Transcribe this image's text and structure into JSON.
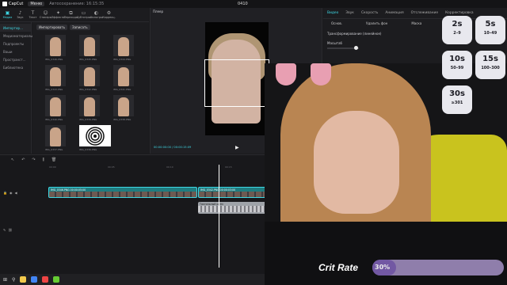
{
  "titlebar": {
    "app": "CapCut",
    "menu": "Меню",
    "autosave": "Автосохранение: 16:15:35",
    "title": "0410"
  },
  "toolbar": [
    {
      "label": "Медиа",
      "icon": "media-icon",
      "active": true
    },
    {
      "label": "Звук",
      "icon": "audio-icon"
    },
    {
      "label": "Текст",
      "icon": "text-icon"
    },
    {
      "label": "Стикеры",
      "icon": "sticker-icon"
    },
    {
      "label": "Эффекты",
      "icon": "effects-icon"
    },
    {
      "label": "Переходы",
      "icon": "transitions-icon"
    },
    {
      "label": "Субтитры",
      "icon": "subtitles-icon"
    },
    {
      "label": "Фильтры",
      "icon": "filters-icon"
    },
    {
      "label": "Коррекц.",
      "icon": "adjust-icon"
    }
  ],
  "sidebar": [
    "Импортир...",
    "Медиаматериалы",
    "Подпроекты",
    "Ваши",
    "Пространст...",
    "Библиотека"
  ],
  "media": {
    "import_btn": "Импортировать",
    "record_btn": "Записать",
    "clips": [
      {
        "name": "IMG_0346.PNG",
        "tag": "Добавлено"
      },
      {
        "name": "IMG_0345.PNG"
      },
      {
        "name": "IMG_0344.PNG"
      },
      {
        "name": "IMG_0343.PNG"
      },
      {
        "name": "IMG_0342.PNG"
      },
      {
        "name": "IMG_0341.PNG"
      },
      {
        "name": "IMG_0340.PNG"
      },
      {
        "name": "IMG_0339.PNG"
      },
      {
        "name": "IMG_0338.PNG"
      },
      {
        "name": "IMG_0337.PNG"
      },
      {
        "name": "IMG_0336.PNG"
      }
    ]
  },
  "player": {
    "title": "Плеер",
    "time": "00:00:00:00 / 00:00:15:09"
  },
  "props": {
    "tabs": [
      "Видео",
      "Звук",
      "Скорость",
      "Анимация",
      "Отслеживание",
      "Корректировка"
    ],
    "subtabs": [
      "Основ.",
      "Удалить фон",
      "Маска"
    ],
    "transform": "Трансформирование (линейное)",
    "scale": "Масштаб"
  },
  "timeline": {
    "ruler": [
      "00:00",
      "00:05",
      "00:10",
      "00:15"
    ],
    "clip1": "IMG_0346.PNG  00:00:05:00",
    "clip2": "IMG_0342.PNG  00:00:03:00",
    "clip3": "IMG_0341.PNG",
    "audio": "Тактильный ритм"
  },
  "overlay": {
    "crit_label": "Crit Rate",
    "crit_pct": "30%",
    "crit_value": 0.3,
    "cards": [
      {
        "big": "2s",
        "rng": "2–9"
      },
      {
        "big": "5s",
        "rng": "10–49"
      },
      {
        "big": "10s",
        "rng": "50–99"
      },
      {
        "big": "15s",
        "rng": "100–300"
      },
      {
        "big": "30s",
        "rng": "≥301"
      }
    ]
  }
}
